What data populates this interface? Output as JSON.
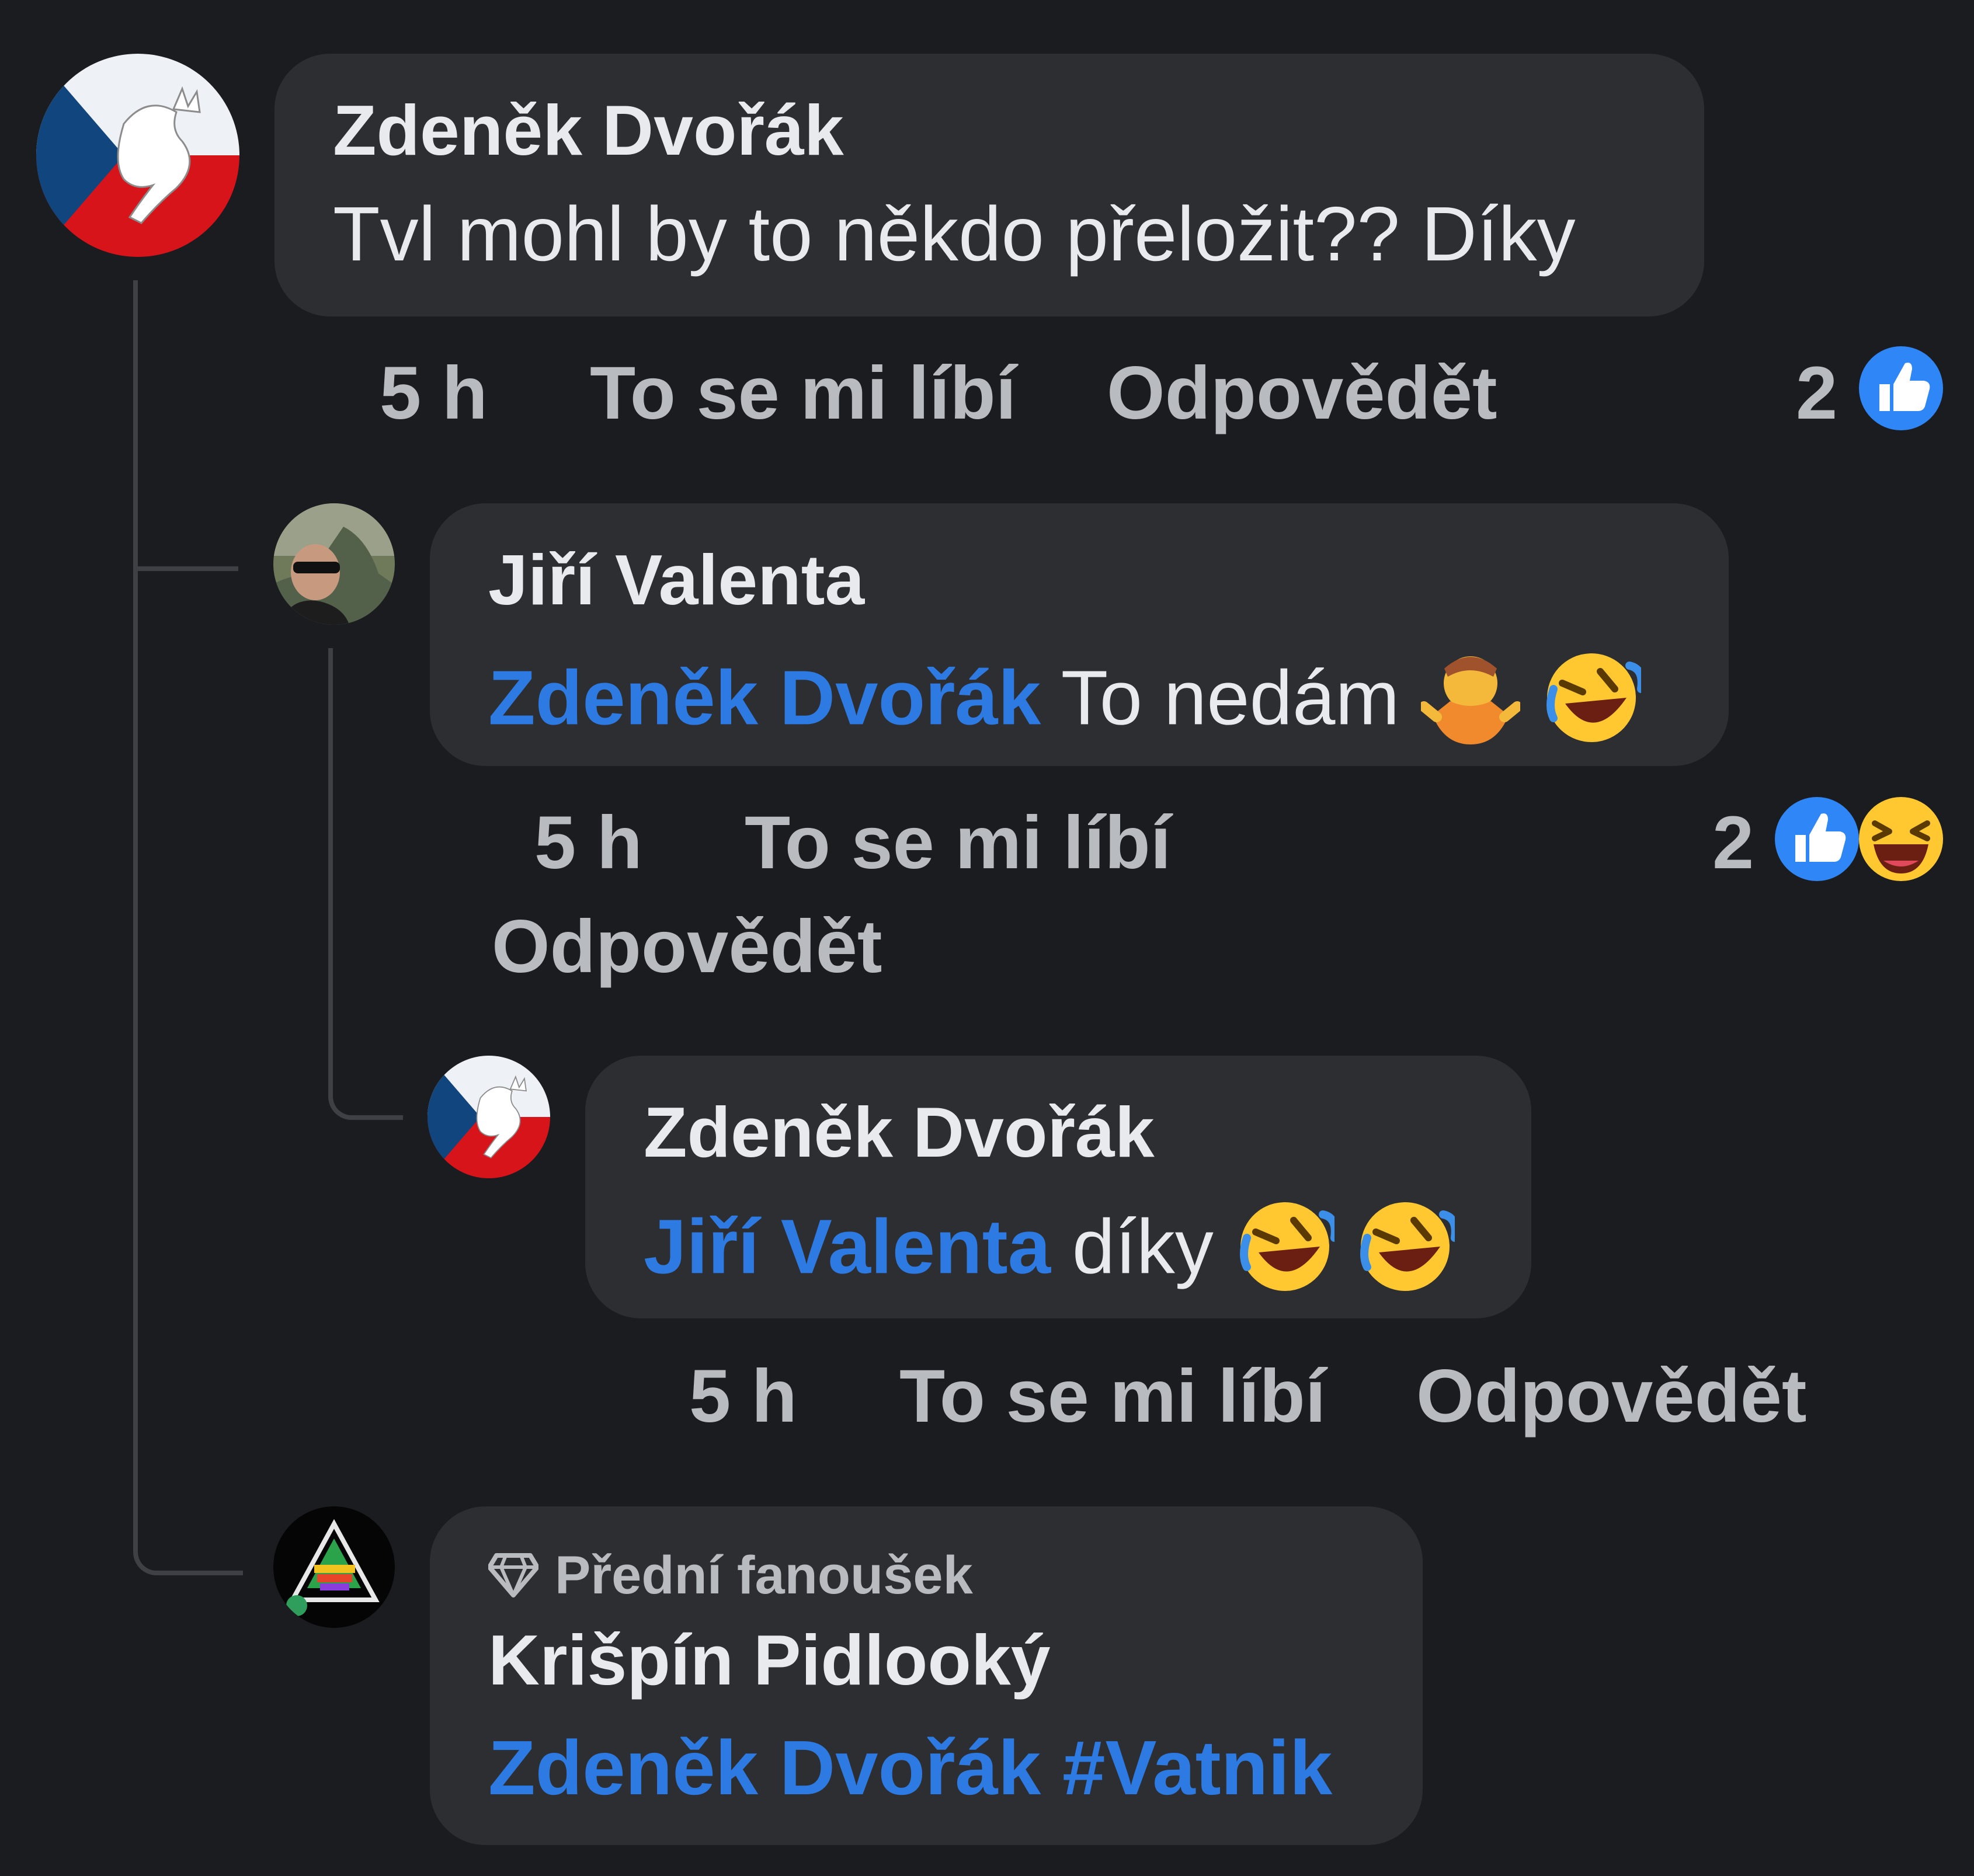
{
  "comments": [
    {
      "author": "Zdeněk Dvořák",
      "text": "Tvl mohl by to někdo přeložit?? Díky",
      "time": "5 h",
      "like_label": "To se mi líbí",
      "reply_label": "Odpovědět",
      "reaction_count": "2",
      "reactions": [
        "like-icon"
      ]
    },
    {
      "author": "Jiří Valenta",
      "mention": "Zdeněk Dvořák",
      "text": "To nedám",
      "emojis": [
        "person-shrugging-emoji",
        "rolling-laughing-emoji"
      ],
      "time": "5 h",
      "like_label": "To se mi líbí",
      "reply_label": "Odpovědět",
      "reaction_count": "2",
      "reactions": [
        "like-icon",
        "laughing-icon"
      ]
    },
    {
      "author": "Zdeněk Dvořák",
      "mention": "Jiří Valenta",
      "text": "díky",
      "emojis": [
        "rolling-laughing-emoji",
        "rolling-laughing-emoji"
      ],
      "time": "5 h",
      "like_label": "To se mi líbí",
      "reply_label": "Odpovědět"
    },
    {
      "badge": "Přední fanoušek",
      "author": "Krišpín Pidlooký",
      "mention": "Zdeněk Dvořák",
      "hashtag": "#Vatnik"
    }
  ],
  "colors": {
    "background": "#1b1c20",
    "bubble": "#2d2e31",
    "mention": "#2d7ae3",
    "like_blue": "#2f86f6",
    "secondary_text": "#b8bbbf"
  }
}
